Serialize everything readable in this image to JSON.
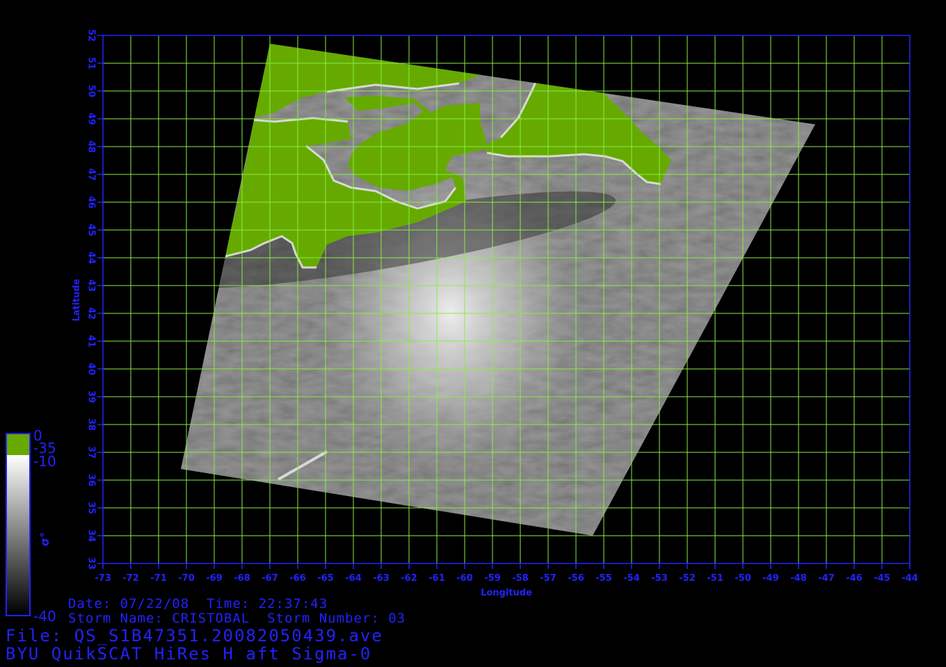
{
  "axes": {
    "xlabel": "Longitude",
    "ylabel": "Latitude",
    "lon_range": [
      -73,
      -44
    ],
    "lat_range": [
      33,
      52
    ],
    "lon_ticks": [
      "-73",
      "-72",
      "-71",
      "-70",
      "-69",
      "-68",
      "-67",
      "-66",
      "-65",
      "-64",
      "-63",
      "-62",
      "-61",
      "-60",
      "-59",
      "-58",
      "-57",
      "-56",
      "-55",
      "-54",
      "-53",
      "-52",
      "-51",
      "-50",
      "-49",
      "-48",
      "-47",
      "-46",
      "-45",
      "-44"
    ],
    "lat_ticks": [
      "33",
      "34",
      "35",
      "36",
      "37",
      "38",
      "39",
      "40",
      "41",
      "42",
      "43",
      "44",
      "45",
      "46",
      "47",
      "48",
      "49",
      "50",
      "51",
      "52"
    ],
    "grid": true,
    "grid_color": "#88ee44",
    "axis_color": "#2222ff"
  },
  "swath": {
    "corners_lonlat": [
      [
        -67.0,
        51.7
      ],
      [
        -47.4,
        48.8
      ],
      [
        -55.4,
        34.0
      ],
      [
        -70.2,
        36.4
      ]
    ],
    "land_color": "#66aa00"
  },
  "storm": {
    "center_lonlat": [
      -60.5,
      42.0
    ]
  },
  "colorbar": {
    "green_top": "0",
    "green_bottom": "-35",
    "gray_top": "-10",
    "gray_bottom": "-40",
    "symbol": "σ°",
    "green_color": "#66aa00",
    "border_color": "#2222ff"
  },
  "info": {
    "date_line": "Date: 07/22/08  Time: 22:37:43",
    "storm_line": "Storm Name: CRISTOBAL  Storm Number: 03",
    "file_line": "File: QS_S1B47351.20082050439.ave",
    "product_line": "BYU QuikSCAT HiRes H aft Sigma-0"
  }
}
